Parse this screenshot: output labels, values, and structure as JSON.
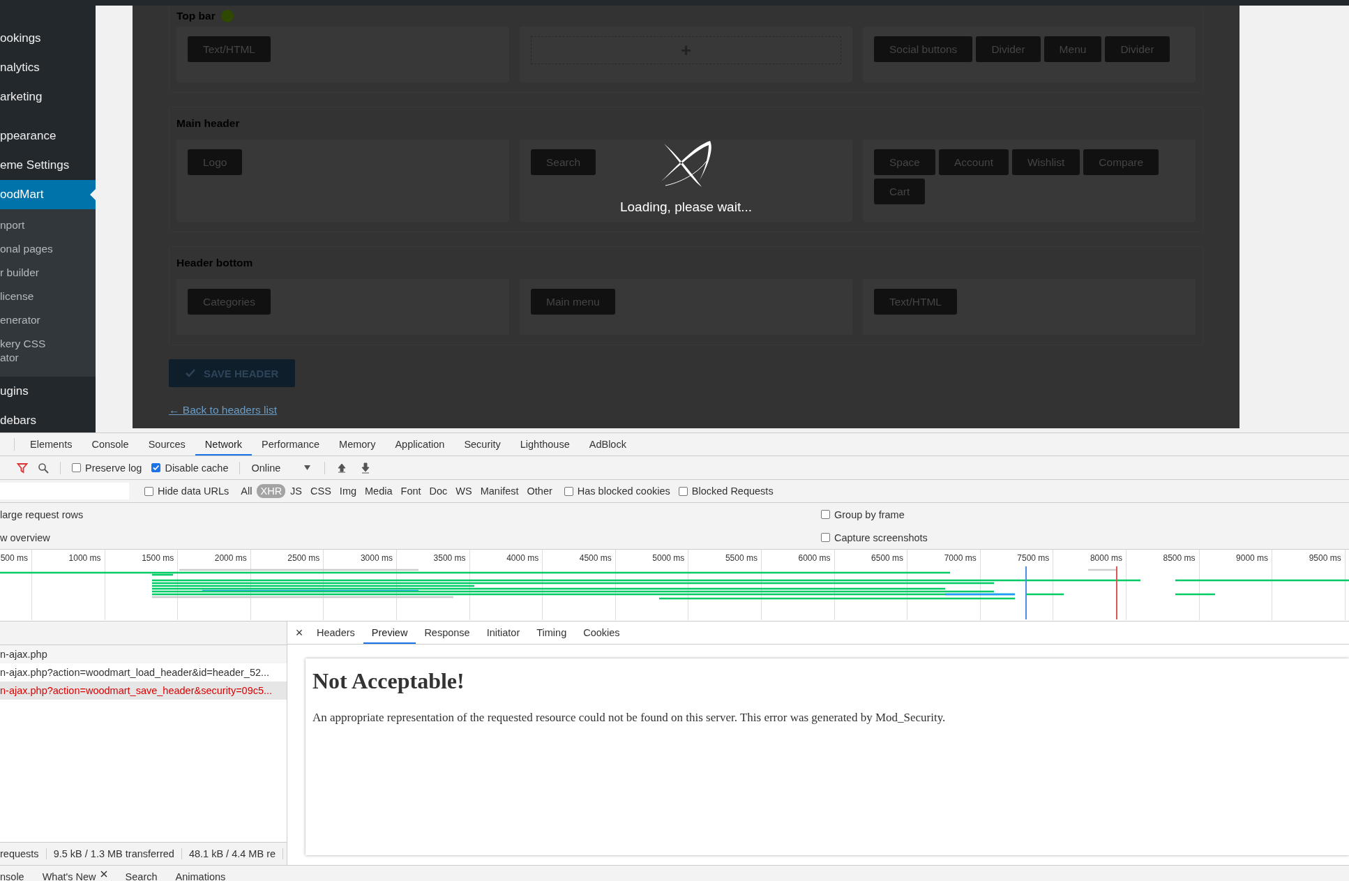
{
  "admin_sidebar": {
    "items": [
      {
        "label": "ookings",
        "kind": "menu",
        "selected": false
      },
      {
        "label": "nalytics",
        "kind": "menu",
        "selected": false
      },
      {
        "label": "arketing",
        "kind": "menu",
        "selected": false
      },
      {
        "label": "ppearance",
        "kind": "menu",
        "selected": false
      },
      {
        "label": "eme Settings",
        "kind": "menu",
        "selected": false
      },
      {
        "label": "oodMart",
        "kind": "menu",
        "selected": true
      },
      {
        "label": "nport",
        "kind": "submenu",
        "selected": false
      },
      {
        "label": "onal pages",
        "kind": "submenu",
        "selected": false
      },
      {
        "label": "r builder",
        "kind": "submenu",
        "selected": false
      },
      {
        "label": "license",
        "kind": "submenu",
        "selected": false
      },
      {
        "label": "enerator",
        "kind": "submenu",
        "selected": false
      },
      {
        "label": "kery CSS ator",
        "kind": "submenu",
        "selected": false
      },
      {
        "label": "ugins",
        "kind": "menu",
        "selected": false
      },
      {
        "label": "debars",
        "kind": "menu",
        "selected": false
      }
    ]
  },
  "header_builder": {
    "rows": [
      {
        "title": "Top bar",
        "indicator": true,
        "columns": [
          {
            "kind": "elements",
            "elements": [
              "Text/HTML"
            ]
          },
          {
            "kind": "add",
            "label": "+"
          },
          {
            "kind": "elements",
            "elements": [
              "Social buttons",
              "Divider",
              "Menu",
              "Divider"
            ]
          }
        ]
      },
      {
        "title": "Main header",
        "indicator": false,
        "columns": [
          {
            "kind": "elements",
            "elements": [
              "Logo"
            ]
          },
          {
            "kind": "elements",
            "elements": [
              "Search"
            ]
          },
          {
            "kind": "elements",
            "elements": [
              "Space",
              "Account",
              "Wishlist",
              "Compare",
              "Cart"
            ]
          }
        ]
      },
      {
        "title": "Header bottom",
        "indicator": false,
        "columns": [
          {
            "kind": "elements",
            "elements": [
              "Categories"
            ]
          },
          {
            "kind": "elements",
            "elements": [
              "Main menu"
            ]
          },
          {
            "kind": "elements",
            "elements": [
              "Text/HTML"
            ]
          }
        ]
      }
    ],
    "save_button": "SAVE HEADER",
    "back_link": "← Back to headers list",
    "loading_text": "Loading, please wait..."
  },
  "devtools": {
    "tabs": [
      {
        "label": "Elements",
        "selected": false
      },
      {
        "label": "Console",
        "selected": false
      },
      {
        "label": "Sources",
        "selected": false
      },
      {
        "label": "Network",
        "selected": true
      },
      {
        "label": "Performance",
        "selected": false
      },
      {
        "label": "Memory",
        "selected": false
      },
      {
        "label": "Application",
        "selected": false
      },
      {
        "label": "Security",
        "selected": false
      },
      {
        "label": "Lighthouse",
        "selected": false
      },
      {
        "label": "AdBlock",
        "selected": false
      }
    ],
    "toolbar": {
      "preserve_log": {
        "label": "Preserve log",
        "checked": false
      },
      "disable_cache": {
        "label": "Disable cache",
        "checked": true
      },
      "throttling": "Online"
    },
    "filter": {
      "hide_data_urls": {
        "label": "Hide data URLs",
        "checked": false
      },
      "types": [
        {
          "label": "All",
          "selected": false
        },
        {
          "label": "XHR",
          "selected": true
        },
        {
          "label": "JS",
          "selected": false
        },
        {
          "label": "CSS",
          "selected": false
        },
        {
          "label": "Img",
          "selected": false
        },
        {
          "label": "Media",
          "selected": false
        },
        {
          "label": "Font",
          "selected": false
        },
        {
          "label": "Doc",
          "selected": false
        },
        {
          "label": "WS",
          "selected": false
        },
        {
          "label": "Manifest",
          "selected": false
        },
        {
          "label": "Other",
          "selected": false
        }
      ],
      "toggles": [
        {
          "label": "Has blocked cookies",
          "checked": false
        },
        {
          "label": "Blocked Requests",
          "checked": false
        }
      ]
    },
    "settings": [
      {
        "label": "large request rows",
        "option": "Group by frame",
        "checked": false
      },
      {
        "label": "w overview",
        "option": "Capture screenshots",
        "checked": false
      }
    ],
    "timeline_ticks": [
      "500 ms",
      "1000 ms",
      "1500 ms",
      "2000 ms",
      "2500 ms",
      "3000 ms",
      "3500 ms",
      "4000 ms",
      "4500 ms",
      "5000 ms",
      "5500 ms",
      "6000 ms",
      "6500 ms",
      "7000 ms",
      "7500 ms",
      "8000 ms",
      "8500 ms",
      "9000 ms",
      "9500 ms"
    ],
    "requests": [
      {
        "name": "n-ajax.php",
        "failed": false,
        "selected": false
      },
      {
        "name": "n-ajax.php?action=woodmart_load_header&id=header_52...",
        "failed": false,
        "selected": false
      },
      {
        "name": "n-ajax.php?action=woodmart_save_header&security=09c5...",
        "failed": true,
        "selected": true
      }
    ],
    "status_bar": [
      "requests",
      "9.5 kB / 1.3 MB transferred",
      "48.1 kB / 4.4 MB re"
    ],
    "detail_tabs": [
      {
        "label": "Headers",
        "selected": false
      },
      {
        "label": "Preview",
        "selected": true
      },
      {
        "label": "Response",
        "selected": false
      },
      {
        "label": "Initiator",
        "selected": false
      },
      {
        "label": "Timing",
        "selected": false
      },
      {
        "label": "Cookies",
        "selected": false
      }
    ],
    "close_label": "×",
    "preview": {
      "heading": "Not Acceptable!",
      "body": "An appropriate representation of the requested resource could not be found on this server. This error was generated by Mod_Security."
    },
    "drawer_tabs": [
      {
        "label": "nsole",
        "closable": false
      },
      {
        "label": "What's New",
        "closable": true
      },
      {
        "label": "Search",
        "closable": false
      },
      {
        "label": "Animations",
        "closable": false
      }
    ]
  }
}
